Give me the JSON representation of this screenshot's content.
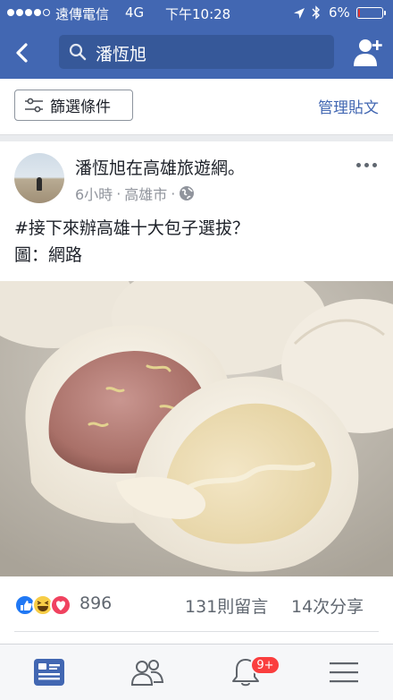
{
  "status_bar": {
    "carrier": "遠傳電信",
    "network": "4G",
    "time": "下午10:28",
    "battery_percent": "6%",
    "battery_level": 0.06,
    "signal_bars_filled": 4
  },
  "nav": {
    "search_query": "潘恆旭",
    "back_icon": "chevron-left-icon",
    "friend_icon": "add-friend-icon"
  },
  "filters": {
    "filter_label": "篩選條件",
    "manage_label": "管理貼文"
  },
  "post": {
    "author_line": "潘恆旭在高雄旅遊網。",
    "time_ago": "6小時",
    "location": "高雄市",
    "separator": "·",
    "privacy_icon": "globe-icon",
    "text_lines": [
      "#接下來辦高雄十大包子選拔？",
      "圖：網路"
    ],
    "reactions_count": "896",
    "comments": "131則留言",
    "shares": "14次分享"
  },
  "tabbar": {
    "tabs": [
      "news-feed-icon",
      "friends-icon",
      "notifications-icon",
      "menu-icon"
    ],
    "active_tab": "news-feed-icon",
    "notification_badge": "9+"
  },
  "colors": {
    "brand": "#4267b2",
    "brand_dark": "#365899",
    "like_blue": "#2078f4",
    "badge_red": "#fa3e3e",
    "love_red": "#f0425f",
    "haha_yellow": "#f7cd46"
  }
}
